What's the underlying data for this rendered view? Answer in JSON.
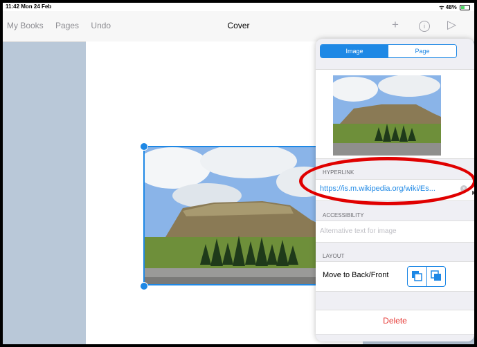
{
  "status": {
    "time_date": "11:42  Mon 24 Feb",
    "right": "48%"
  },
  "nav": {
    "my_books": "My Books",
    "pages": "Pages",
    "undo": "Undo",
    "title": "Cover",
    "plus_icon": "+",
    "info_icon": "i",
    "play_icon": "▷"
  },
  "popover": {
    "seg_image": "Image",
    "seg_page": "Page",
    "hyperlink_label": "HYPERLINK",
    "hyperlink_value": "https://is.m.wikipedia.org/wiki/Es...",
    "accessibility_label": "ACCESSIBILITY",
    "alt_placeholder": "Alternative text for image",
    "layout_label": "LAYOUT",
    "move_label": "Move to Back/Front",
    "delete_label": "Delete"
  }
}
